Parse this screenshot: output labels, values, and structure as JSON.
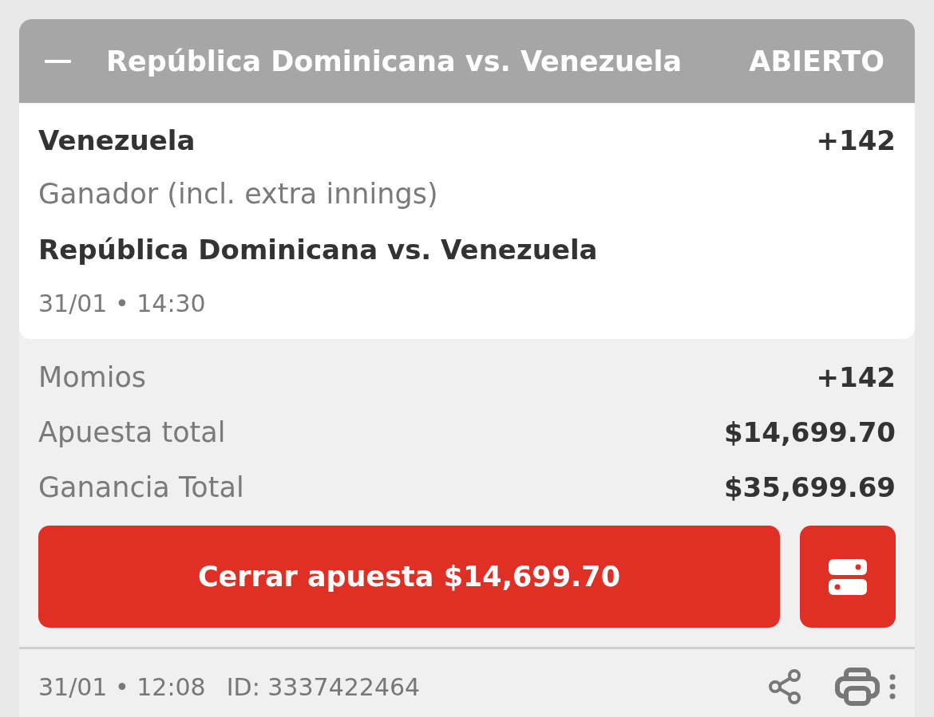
{
  "bet_header": {
    "title": "República Dominicana vs. Venezuela",
    "status": "ABIERTO"
  },
  "selection": {
    "pick": "Venezuela",
    "odds": "+142",
    "market": "Ganador (incl. extra innings)",
    "event": "República Dominicana vs. Venezuela",
    "event_time": "31/01 • 14:30"
  },
  "summary": [
    {
      "label": "Momios",
      "value": "+142"
    },
    {
      "label": "Apuesta total",
      "value": "$14,699.70"
    },
    {
      "label": "Ganancia Total",
      "value": "$35,699.69"
    }
  ],
  "cashout_button": {
    "label": "Cerrar apuesta $14,699.70"
  },
  "footer": {
    "placed_time": "31/01 • 12:08",
    "bet_id": "ID: 3337422464"
  }
}
